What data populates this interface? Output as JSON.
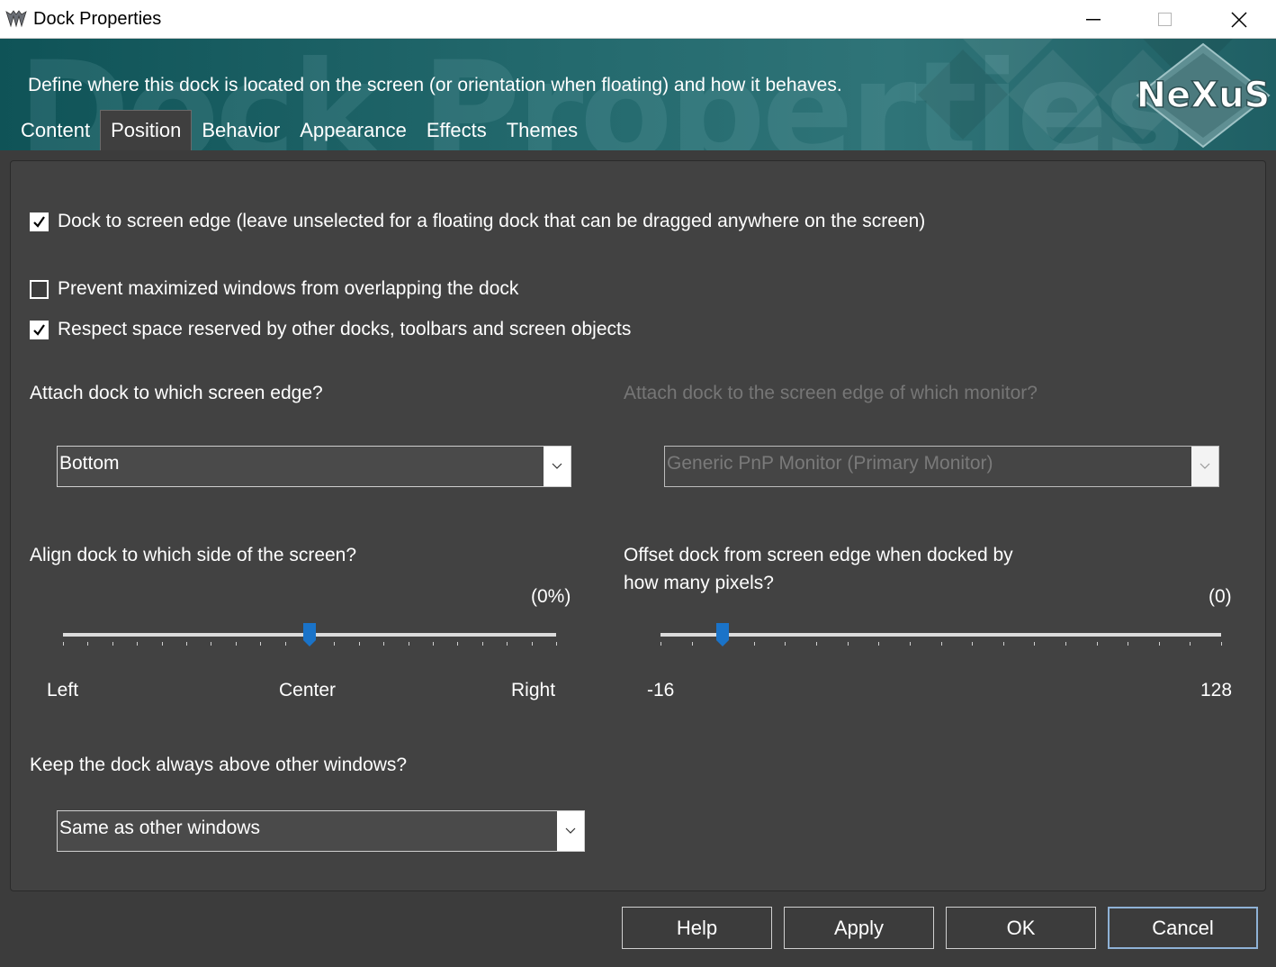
{
  "window": {
    "title": "Dock Properties",
    "minimize_icon": "minimize-icon",
    "maximize_icon": "maximize-icon",
    "close_icon": "close-icon"
  },
  "banner": {
    "watermark": "Dock Properties",
    "description": "Define where this dock is located on the screen (or orientation when floating) and how it behaves.",
    "logo_text": "NeXuS"
  },
  "tabs": [
    {
      "label": "Content",
      "active": false
    },
    {
      "label": "Position",
      "active": true
    },
    {
      "label": "Behavior",
      "active": false
    },
    {
      "label": "Appearance",
      "active": false
    },
    {
      "label": "Effects",
      "active": false
    },
    {
      "label": "Themes",
      "active": false
    }
  ],
  "options": {
    "dock_to_edge": {
      "label": "Dock to screen edge (leave unselected for a floating dock that can be dragged anywhere on the screen)",
      "checked": true
    },
    "prevent_overlap": {
      "label": "Prevent maximized windows from overlapping the dock",
      "checked": false
    },
    "respect_space": {
      "label": "Respect space reserved by other docks, toolbars and screen objects",
      "checked": true
    }
  },
  "edge": {
    "label": "Attach dock to which screen edge?",
    "value": "Bottom"
  },
  "monitor": {
    "label": "Attach dock to the screen edge of which monitor?",
    "value": "Generic PnP Monitor (Primary Monitor)",
    "disabled": true
  },
  "align": {
    "label": "Align dock to which side of the screen?",
    "readout": "(0%)",
    "fraction": 0.5,
    "min_label": "Left",
    "mid_label": "Center",
    "max_label": "Right"
  },
  "offset": {
    "label_line1": "Offset dock from screen edge when docked by",
    "label_line2": "how many pixels?",
    "readout": "(0)",
    "value": 0,
    "min": -16,
    "max": 128,
    "min_label": "-16",
    "max_label": "128"
  },
  "zorder": {
    "label": "Keep the dock always above other windows?",
    "value": "Same as other windows"
  },
  "buttons": {
    "help": "Help",
    "apply": "Apply",
    "ok": "OK",
    "cancel": "Cancel"
  },
  "colors": {
    "background": "#3c3c3c",
    "panel": "#424242",
    "banner": "#246a6e",
    "slider_thumb": "#1a73c8",
    "default_button_border": "#8fb2d6"
  }
}
